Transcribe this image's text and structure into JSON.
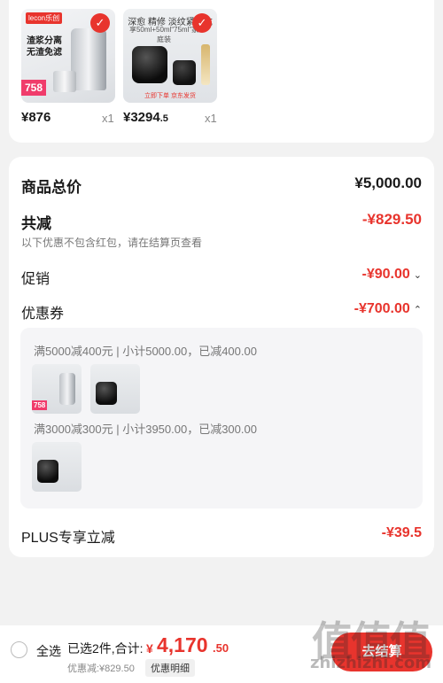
{
  "items": [
    {
      "brand": "lecon乐创",
      "image_text": "渣浆分离\n无渣免滤",
      "image_price": "758",
      "price": "¥876",
      "price_dec": "",
      "qty": "x1"
    },
    {
      "brand": "HR",
      "image_text": "深愈 精修 淡纹紧塑抗",
      "image_sub": "享50ml+50ml“75ml”家庭装",
      "image_footer": "立即下单 京东发货",
      "price": "¥3294",
      "price_dec": ".5",
      "qty": "x1"
    }
  ],
  "summary": {
    "total_label": "商品总价",
    "total_value": "¥5,000.00",
    "reduce_label": "共减",
    "reduce_value": "-¥829.50",
    "reduce_note": "以下优惠不包含红包，请在结算页查看",
    "promo_label": "促销",
    "promo_value": "-¥90.00",
    "coupon_label": "优惠券",
    "coupon_value": "-¥700.00",
    "plus_label": "PLUS专享立减",
    "plus_value": "-¥39.5"
  },
  "coupons": [
    {
      "text": "满5000减400元 | 小计5000.00，已减400.00"
    },
    {
      "text": "满3000减300元 | 小计3950.00，已减300.00"
    }
  ],
  "bottom_bar": {
    "select_all": "全选",
    "selected_count": "已选2件,合计:",
    "currency": "¥",
    "total_int": "4,170",
    "total_dec": ".50",
    "discount": "优惠减:¥829.50",
    "detail_btn": "优惠明细",
    "checkout": "去结算"
  },
  "watermark": {
    "logo": "值值值",
    "url": "zhizhizhi.com"
  },
  "colors": {
    "accent": "#e8342d",
    "background": "#f2f2f2"
  },
  "icons": [
    "check-icon",
    "chevron-down-icon",
    "chevron-up-icon",
    "radio-icon"
  ]
}
